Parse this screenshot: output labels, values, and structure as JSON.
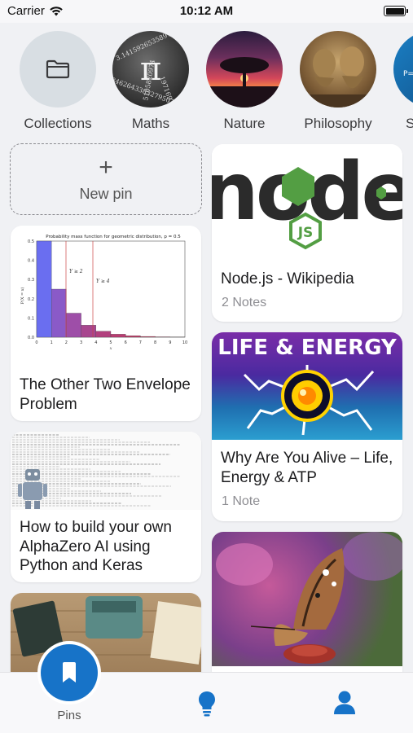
{
  "status_bar": {
    "carrier": "Carrier",
    "time": "10:12 AM"
  },
  "collections": [
    {
      "label": "Collections",
      "icon": "folder-icon"
    },
    {
      "label": "Maths"
    },
    {
      "label": "Nature"
    },
    {
      "label": "Philosophy"
    },
    {
      "label": "S"
    }
  ],
  "new_pin": {
    "plus": "+",
    "label": "New pin"
  },
  "pins": {
    "nodejs": {
      "title": "Node.js - Wikipedia",
      "notes": "2 Notes",
      "logo_text": "node",
      "badge_text": "JS"
    },
    "envelope": {
      "title": "The Other Two Envelope Problem",
      "chart_title": "Probability mass function for geometric distribution, p = 0.5",
      "chart_data": {
        "type": "bar",
        "title": "Probability mass function for geometric distribution, p = 0.5",
        "ylabel": "P(X = x)",
        "xlabel": "x",
        "categories": [
          1,
          2,
          3,
          4,
          5,
          6,
          7,
          8,
          9,
          10
        ],
        "values": [
          0.5,
          0.25,
          0.125,
          0.0625,
          0.03125,
          0.015625,
          0.0078,
          0.0039,
          0.002,
          0.001
        ],
        "ylim": [
          0,
          0.5
        ],
        "xlim": [
          0,
          10
        ],
        "y_ticks": [
          "0.0",
          "0.1",
          "0.2",
          "0.3",
          "0.4",
          "0.5"
        ],
        "x_ticks": [
          "0",
          "1",
          "2",
          "3",
          "4",
          "5",
          "6",
          "7",
          "8",
          "9",
          "10"
        ],
        "annotations": [
          "Y ≥ 2",
          "Y ≥ 4"
        ]
      }
    },
    "life": {
      "title": "Why Are You Alive – Life, Energy & ATP",
      "notes": "1 Note",
      "banner": "LIFE & ENERGY"
    },
    "alphazero": {
      "title": "How to build your own AlphaZero AI using Python and Keras"
    },
    "butterfly": {},
    "desk": {}
  },
  "tabs": {
    "pins_label": "Pins"
  },
  "colors": {
    "accent": "#1773c8",
    "node_green": "#539e43"
  }
}
